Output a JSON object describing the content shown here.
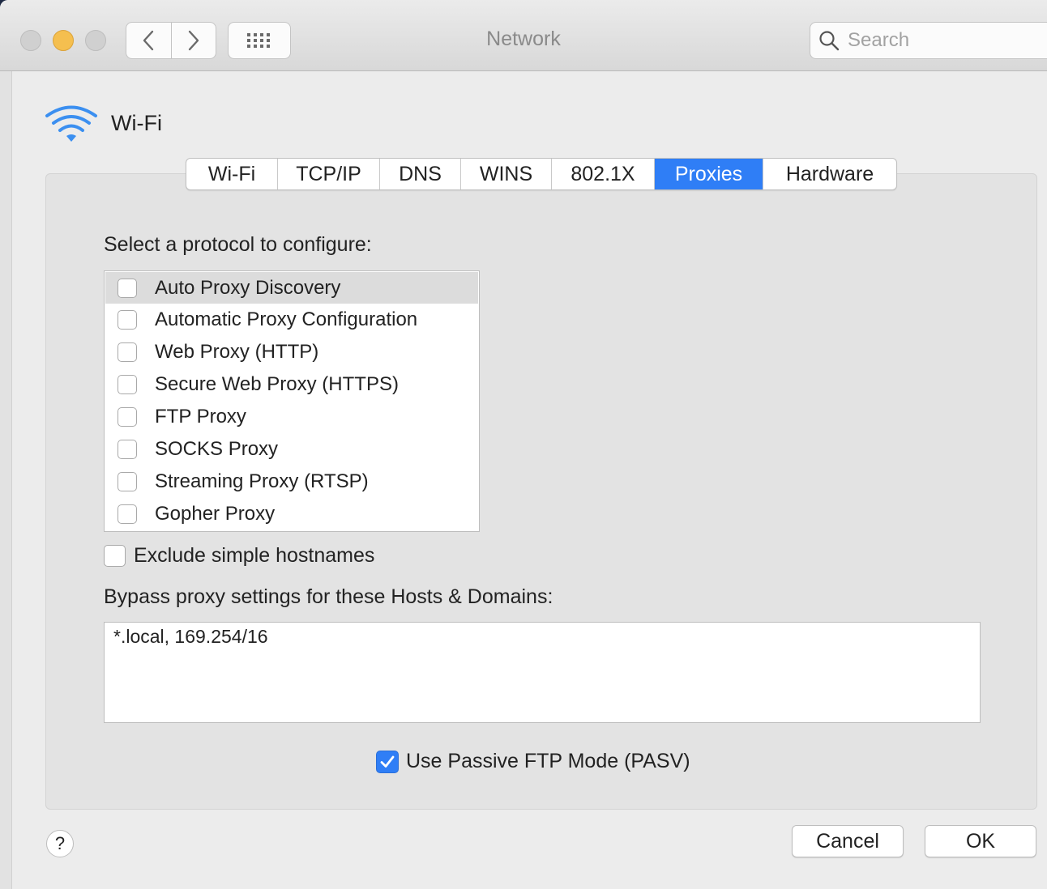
{
  "window": {
    "title": "Network",
    "search_placeholder": "Search"
  },
  "header": {
    "label": "Wi-Fi",
    "icon": "wifi-icon"
  },
  "tabs": [
    {
      "label": "Wi-Fi",
      "active": false
    },
    {
      "label": "TCP/IP",
      "active": false
    },
    {
      "label": "DNS",
      "active": false
    },
    {
      "label": "WINS",
      "active": false
    },
    {
      "label": "802.1X",
      "active": false
    },
    {
      "label": "Proxies",
      "active": true
    },
    {
      "label": "Hardware",
      "active": false
    }
  ],
  "proxies": {
    "select_label": "Select a protocol to configure:",
    "protocols": [
      {
        "label": "Auto Proxy Discovery",
        "checked": false,
        "selected": true
      },
      {
        "label": "Automatic Proxy Configuration",
        "checked": false,
        "selected": false
      },
      {
        "label": "Web Proxy (HTTP)",
        "checked": false,
        "selected": false
      },
      {
        "label": "Secure Web Proxy (HTTPS)",
        "checked": false,
        "selected": false
      },
      {
        "label": "FTP Proxy",
        "checked": false,
        "selected": false
      },
      {
        "label": "SOCKS Proxy",
        "checked": false,
        "selected": false
      },
      {
        "label": "Streaming Proxy (RTSP)",
        "checked": false,
        "selected": false
      },
      {
        "label": "Gopher Proxy",
        "checked": false,
        "selected": false
      }
    ],
    "exclude_simple_label": "Exclude simple hostnames",
    "exclude_simple_checked": false,
    "bypass_label": "Bypass proxy settings for these Hosts & Domains:",
    "bypass_value": "*.local, 169.254/16",
    "pasv_label": "Use Passive FTP Mode (PASV)",
    "pasv_checked": true
  },
  "footer": {
    "help_label": "?",
    "cancel_label": "Cancel",
    "ok_label": "OK"
  },
  "colors": {
    "accent": "#2f7ef6",
    "wifi": "#3b8ff0",
    "minimize": "#f5bf4f"
  }
}
